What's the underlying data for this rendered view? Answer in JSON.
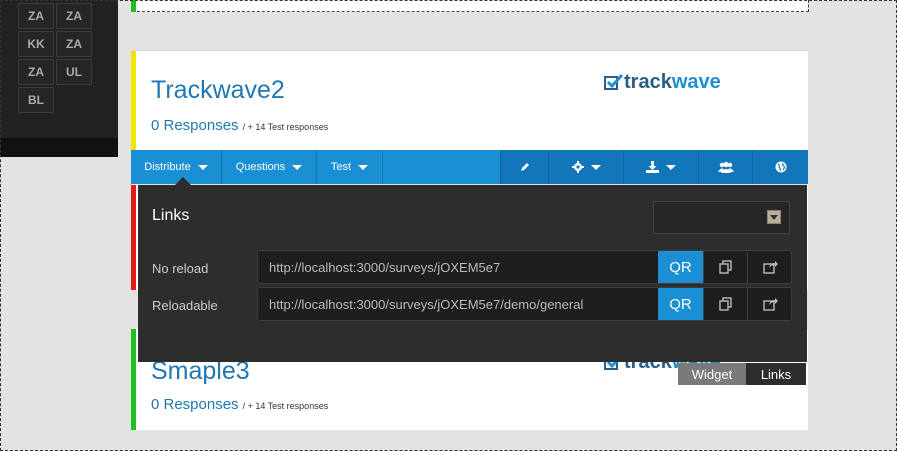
{
  "left_panel": {
    "tiles": [
      "ZA",
      "ZA",
      "KK",
      "ZA",
      "ZA",
      "UL",
      "BL"
    ]
  },
  "survey1": {
    "title": "Trackwave2",
    "responses": "0 Responses",
    "test_responses": "/ + 14 Test responses",
    "stripe_color": "#f2e500"
  },
  "survey2": {
    "stripe_color": "#e31b1b"
  },
  "survey3": {
    "title": "Smaple3",
    "responses": "0 Responses",
    "test_responses": "/ + 14 Test responses",
    "stripe_color": "#1fbf1f"
  },
  "logo": {
    "part1": "track",
    "part2": "wave"
  },
  "toolbar": {
    "distribute": "Distribute",
    "questions": "Questions",
    "test": "Test",
    "icons": [
      "pencil-icon",
      "gear-icon",
      "download-icon",
      "users-icon",
      "globe-icon"
    ]
  },
  "links_panel": {
    "title": "Links",
    "rows": [
      {
        "label": "No reload",
        "url": "http://localhost:3000/surveys/jOXEM5e7",
        "qr": "QR"
      },
      {
        "label": "Reloadable",
        "url": "http://localhost:3000/surveys/jOXEM5e7/demo/general",
        "qr": "QR"
      }
    ]
  },
  "tabs": {
    "widget": "Widget",
    "links": "Links"
  },
  "colors": {
    "accent": "#1a8fd3",
    "panel": "#2d2d2d"
  }
}
